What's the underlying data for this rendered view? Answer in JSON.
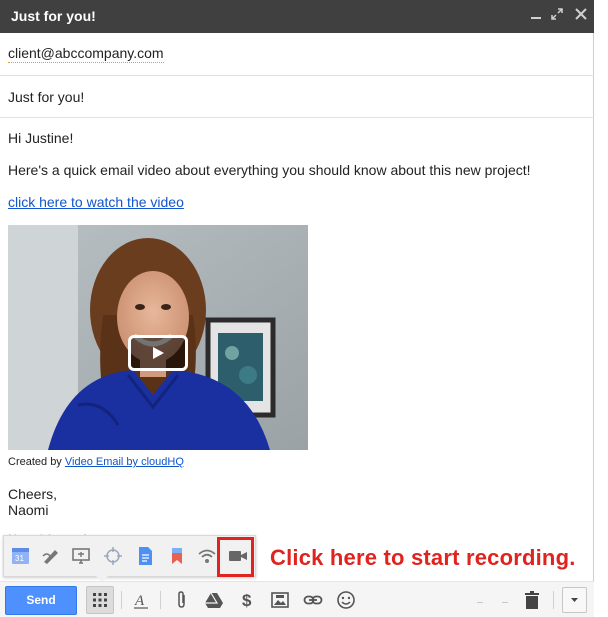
{
  "window": {
    "title": "Just for you!",
    "controls": [
      "_",
      "⤢",
      "✕"
    ]
  },
  "compose": {
    "to": "client@abccompany.com",
    "subject": "Just for you!"
  },
  "message": {
    "greeting": "Hi Justine!",
    "intro": "Here's a quick email video about everything you should know about this new project!",
    "video_link": "click here to watch the video",
    "credit_prefix": "Created by ",
    "credit_link": "Video Email by cloudHQ",
    "signoff": "Cheers,",
    "signature_name": "Naomi",
    "signature_full": "Naomi Assaraf"
  },
  "apps_popup": {
    "icons": [
      "calendar-icon",
      "signature-icon",
      "screen-share-icon",
      "crosshair-icon",
      "document-icon",
      "bookmark-icon",
      "wifi-icon",
      "video-camera-icon"
    ],
    "calendar_label": "31"
  },
  "annotation": {
    "callout": "Click here to start recording.",
    "color": "#e0231f"
  },
  "toolbar": {
    "send_label": "Send",
    "icons": [
      "apps-grid-icon",
      "text-format-icon",
      "attach-icon",
      "drive-icon",
      "dollar-icon",
      "photo-icon",
      "link-icon",
      "emoji-icon",
      "trash-icon",
      "more-options-icon"
    ],
    "send_color": "#4d90fe"
  }
}
